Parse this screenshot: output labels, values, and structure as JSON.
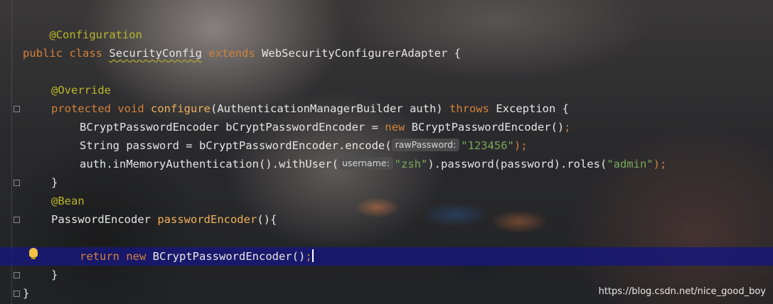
{
  "code": {
    "annotation_configuration": "@Configuration",
    "line_class": {
      "kw_public": "public",
      "kw_class": "class",
      "class_name": "SecurityConfig",
      "kw_extends": "extends",
      "super_class": "WebSecurityConfigurerAdapter",
      "brace": "{"
    },
    "annotation_override": "@Override",
    "line_configure": {
      "kw_protected": "protected",
      "kw_void": "void",
      "method": "configure",
      "params": "(AuthenticationManagerBuilder auth)",
      "kw_throws": "throws",
      "rest": "Exception {"
    },
    "line_encoder_decl": {
      "text": "BCryptPasswordEncoder bCryptPasswordEncoder = ",
      "kw_new": "new",
      "rest": " BCryptPasswordEncoder()",
      "semi": ";"
    },
    "line_password": {
      "text": "String password = bCryptPasswordEncoder.encode(",
      "hint": "rawPassword:",
      "str": "\"123456\"",
      "end": ");"
    },
    "line_auth": {
      "text": "auth.inMemoryAuthentication().withUser(",
      "hint": "username:",
      "str_user": "\"zsh\"",
      "mid": ").password(password).roles(",
      "str_role": "\"admin\"",
      "end": ");"
    },
    "close_method": "}",
    "annotation_bean": "@Bean",
    "line_bean": {
      "type": "PasswordEncoder",
      "method": "passwordEncoder",
      "rest": "(){"
    },
    "line_return": {
      "kw_return": "return",
      "kw_new": "new",
      "rest": " BCryptPasswordEncoder()",
      "semi": ";"
    },
    "close_bean": "}",
    "close_class": "}"
  },
  "watermark": "https://blog.csdn.net/nice_good_boy",
  "colors": {
    "keyword": "#d2813b",
    "annotation": "#bbb529",
    "string": "#7aa95a",
    "method": "#f0b15c",
    "highlight": "#18187a"
  }
}
